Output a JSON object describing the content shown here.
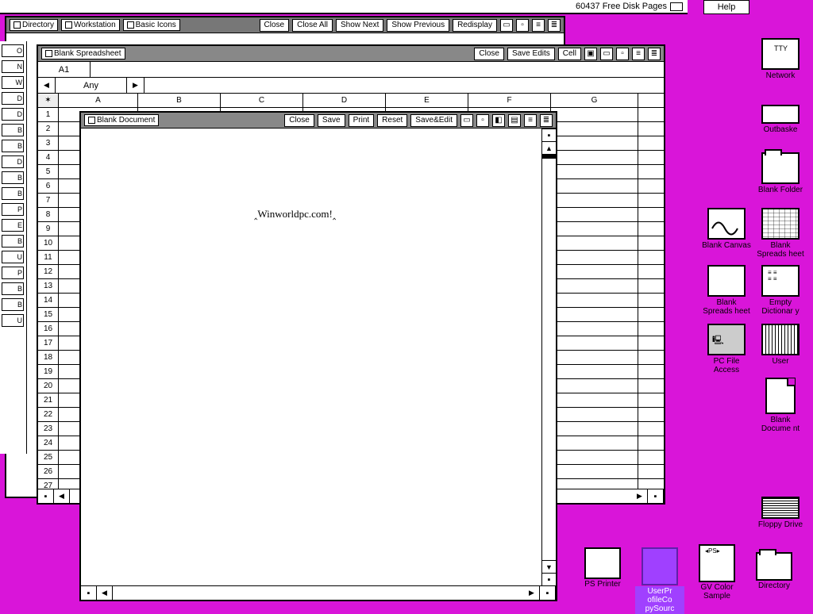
{
  "topbar": {
    "free_disk": "60437 Free Disk Pages",
    "help": "Help"
  },
  "filer": {
    "tabs": [
      "Directory",
      "Workstation",
      "Basic Icons"
    ],
    "buttons": [
      "Close",
      "Close All",
      "Show Next",
      "Show Previous",
      "Redisplay"
    ]
  },
  "iconstrip_items": [
    "O",
    "N",
    "W",
    "D",
    "D",
    "B",
    "B",
    "D",
    "B",
    "B",
    "P",
    "E",
    "B",
    "U",
    "P",
    "B",
    "B",
    "U"
  ],
  "spreadsheet": {
    "title": "Blank Spreadsheet",
    "title_buttons": [
      "Close",
      "Save Edits",
      "Cell"
    ],
    "cellref": "A1",
    "type_label": "Any",
    "cols": [
      "A",
      "B",
      "C",
      "D",
      "E",
      "F",
      "G"
    ],
    "rows": 27
  },
  "doc": {
    "title": "Blank Document",
    "buttons": [
      "Close",
      "Save",
      "Print",
      "Reset",
      "Save&Edit"
    ],
    "content": "Winworldpc.com!"
  },
  "desktop_icons": {
    "network": "Network",
    "outbasket": "Outbaske",
    "blank_folder": "Blank Folder",
    "blank_canvas": "Blank Canvas",
    "blank_spreadsheet": "Blank Spreads heet",
    "blank_spreadsheet2": "Blank Spreads heet",
    "empty_dict": "Empty Dictionar y",
    "pc_file": "PC File Access",
    "user": "User",
    "blank_document": "Blank Docume nt",
    "floppy": "Floppy Drive",
    "ps_printer": "PS Printer",
    "user_profile": "UserPr ofileCo pySourc",
    "gv_color": "GV Color Sample",
    "directory": "Directory",
    "ps_badge": "◂PS▸"
  }
}
